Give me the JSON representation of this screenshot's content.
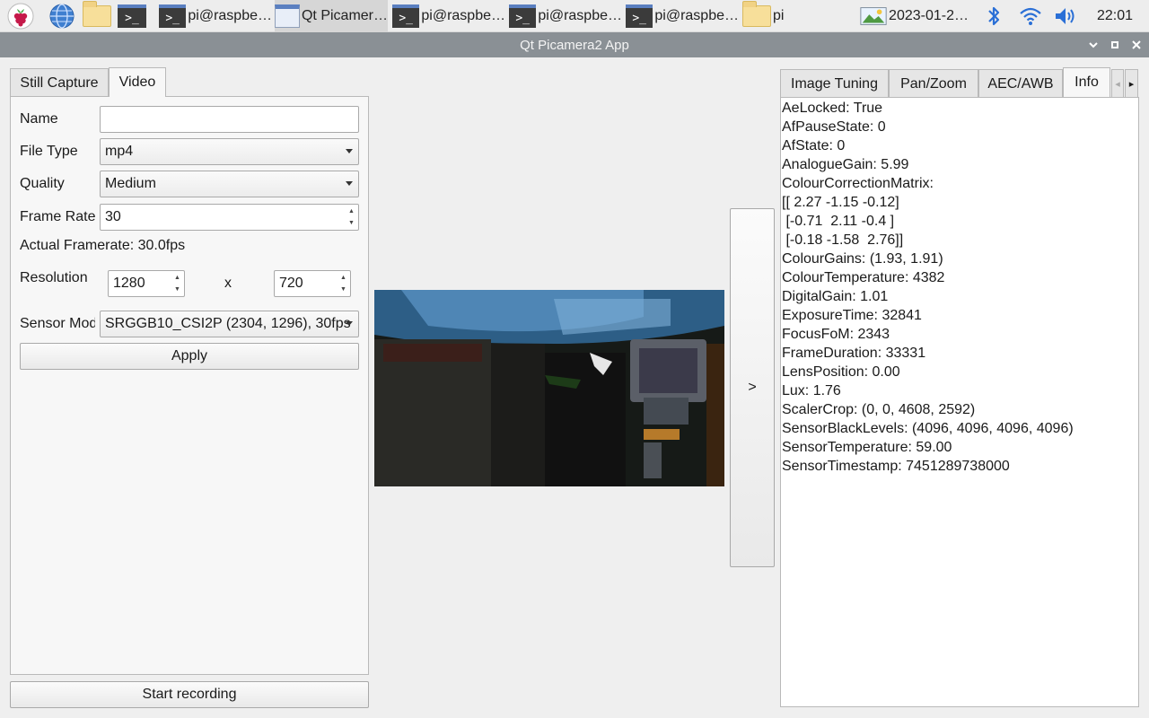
{
  "taskbar": {
    "tasks": [
      {
        "label": "pi@raspbe…"
      },
      {
        "label": "Qt Picamer…"
      },
      {
        "label": "pi@raspbe…"
      },
      {
        "label": "pi@raspbe…"
      },
      {
        "label": "pi@raspbe…"
      },
      {
        "label": "pi"
      }
    ],
    "screenshot_label": "2023-01-2…",
    "terminal_glyph": ">_",
    "clock": "22:01"
  },
  "window": {
    "title": "Qt Picamera2 App",
    "minimize_glyph": "⌄",
    "maximize_glyph": "▪",
    "close_glyph": "✕"
  },
  "left_tabs": [
    "Still Capture",
    "Video"
  ],
  "video_form": {
    "name_label": "Name",
    "name_value": "",
    "file_type_label": "File Type",
    "file_type_value": "mp4",
    "quality_label": "Quality",
    "quality_value": "Medium",
    "frame_rate_label": "Frame Rate",
    "frame_rate_value": "30",
    "actual_framerate": "Actual Framerate: 30.0fps",
    "resolution_label": "Resolution",
    "res_width": "1280",
    "res_sep": "x",
    "res_height": "720",
    "sensor_mode_label": "Sensor Mod",
    "sensor_mode_value": "SRGGB10_CSI2P (2304, 1296), 30fps",
    "apply_label": "Apply"
  },
  "start_recording_label": "Start recording",
  "toggle_panel_label": ">",
  "right_tabs": [
    "Image Tuning",
    "Pan/Zoom",
    "AEC/AWB",
    "Info"
  ],
  "right_tab_scroll": {
    "left": "◂",
    "right": "▸"
  },
  "info_lines": [
    "AeLocked: True",
    "AfPauseState: 0",
    "AfState: 0",
    "AnalogueGain: 5.99",
    "ColourCorrectionMatrix:",
    "[[ 2.27 -1.15 -0.12]",
    " [-0.71  2.11 -0.4 ]",
    " [-0.18 -1.58  2.76]]",
    "ColourGains: (1.93, 1.91)",
    "ColourTemperature: 4382",
    "DigitalGain: 1.01",
    "ExposureTime: 32841",
    "FocusFoM: 2343",
    "FrameDuration: 33331",
    "LensPosition: 0.00",
    "Lux: 1.76",
    "ScalerCrop: (0, 0, 4608, 2592)",
    "SensorBlackLevels: (4096, 4096, 4096, 4096)",
    "SensorTemperature: 59.00",
    "SensorTimestamp: 7451289738000"
  ],
  "colors": {
    "titlebar": "#8a9095",
    "bluetooth": "#2a6fd6",
    "accent": "#5a7fc0"
  }
}
